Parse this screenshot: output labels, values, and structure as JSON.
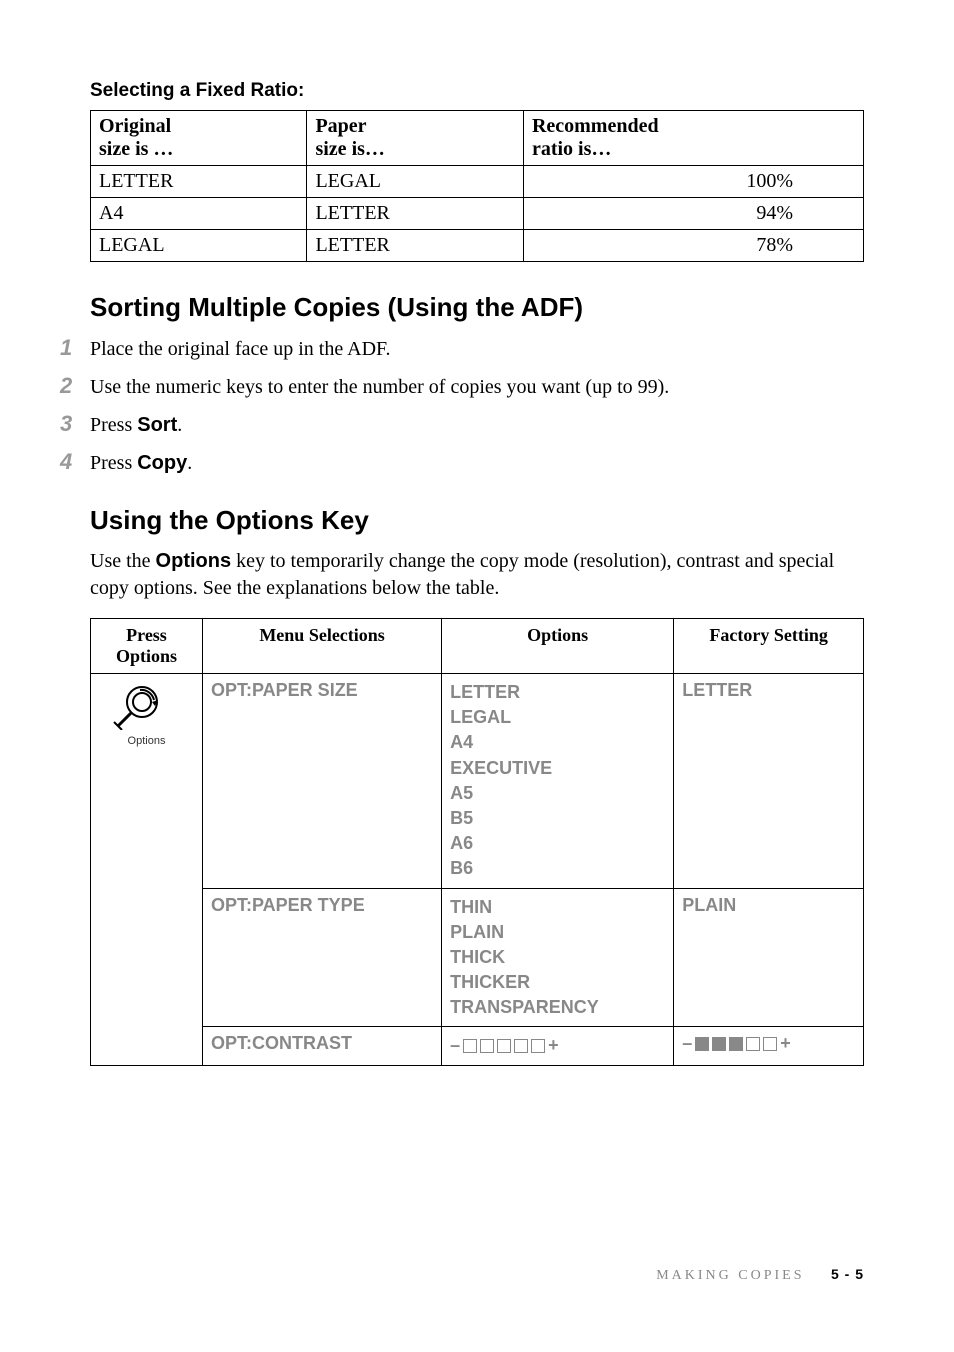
{
  "section1": {
    "title": "Selecting a Fixed Ratio:",
    "table": {
      "headers": {
        "col1a": "Original",
        "col1b": "size is …",
        "col2a": "Paper",
        "col2b": "size is…",
        "col3a": "Recommended",
        "col3b": "ratio is…"
      },
      "rows": [
        {
          "orig": "LETTER",
          "paper": "LEGAL",
          "ratio": "100%"
        },
        {
          "orig": "A4",
          "paper": "LETTER",
          "ratio": "94%"
        },
        {
          "orig": "LEGAL",
          "paper": "LETTER",
          "ratio": "78%"
        }
      ]
    }
  },
  "section2": {
    "heading": "Sorting Multiple Copies (Using the ADF)",
    "steps": [
      {
        "n": "1",
        "text_before": "Place the original face up in the ADF.",
        "bold": "",
        "text_after": ""
      },
      {
        "n": "2",
        "text_before": "Use the numeric keys to enter the number of copies you want (up to 99).",
        "bold": "",
        "text_after": ""
      },
      {
        "n": "3",
        "text_before": "Press ",
        "bold": "Sort",
        "text_after": "."
      },
      {
        "n": "4",
        "text_before": "Press ",
        "bold": "Copy",
        "text_after": "."
      }
    ]
  },
  "section3": {
    "heading": "Using the Options Key",
    "para_before": "Use the ",
    "para_bold": "Options",
    "para_after": " key to temporarily change the copy mode (resolution), contrast and special copy options. See the explanations below the table.",
    "table": {
      "headers": {
        "press1": "Press",
        "press2": "Options",
        "menu": "Menu Selections",
        "options": "Options",
        "factory": "Factory Setting"
      },
      "icon_label": "Options",
      "rows": [
        {
          "menu": "OPT:PAPER SIZE",
          "options": [
            "LETTER",
            "LEGAL",
            "A4",
            "EXECUTIVE",
            "A5",
            "B5",
            "A6",
            "B6"
          ],
          "factory": "LETTER"
        },
        {
          "menu": "OPT:PAPER TYPE",
          "options": [
            "THIN",
            "PLAIN",
            "THICK",
            "THICKER",
            "TRANSPARENCY"
          ],
          "factory": "PLAIN"
        },
        {
          "menu": "OPT:CONTRAST",
          "options_contrast": {
            "minus": "–",
            "plus": "+",
            "filled": 0,
            "total": 5
          },
          "factory_contrast": {
            "minus": "–",
            "plus": "+",
            "filled": 3,
            "total": 5
          }
        }
      ]
    }
  },
  "footer": {
    "section": "MAKING COPIES",
    "page": "5 - 5"
  }
}
